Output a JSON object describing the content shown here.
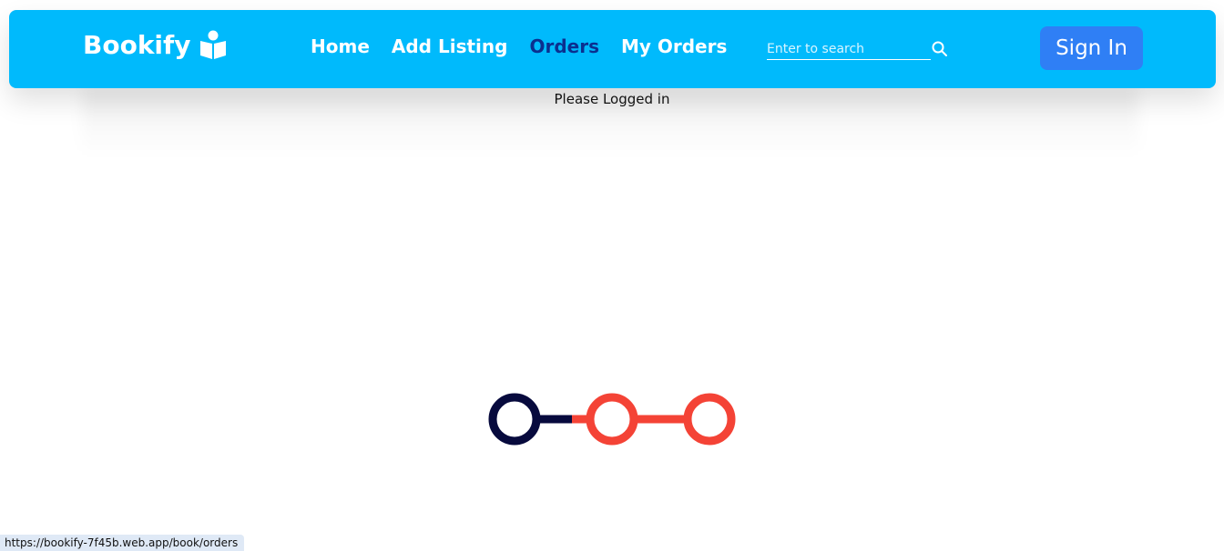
{
  "app": {
    "brand_name": "Bookify",
    "brand_icon": "book-reader-icon"
  },
  "nav": {
    "home": "Home",
    "add_listing": "Add Listing",
    "orders": "Orders",
    "my_orders": "My Orders"
  },
  "search": {
    "placeholder": "Enter to search",
    "value": "",
    "icon": "search-icon"
  },
  "auth": {
    "signin_label": "Sign In"
  },
  "main": {
    "message": "Please Logged in"
  },
  "loader": {
    "icon": "loading-dots-icon"
  },
  "status": {
    "url": "https://bookify-7f45b.web.app/book/orders"
  },
  "colors": {
    "navbar": "#00bafc",
    "active_nav": "#0b2f8f",
    "signin_button": "#2f7ff5",
    "loader_dark": "#070a3d",
    "loader_red": "#f44336",
    "status_bg": "#dfe9f6"
  }
}
